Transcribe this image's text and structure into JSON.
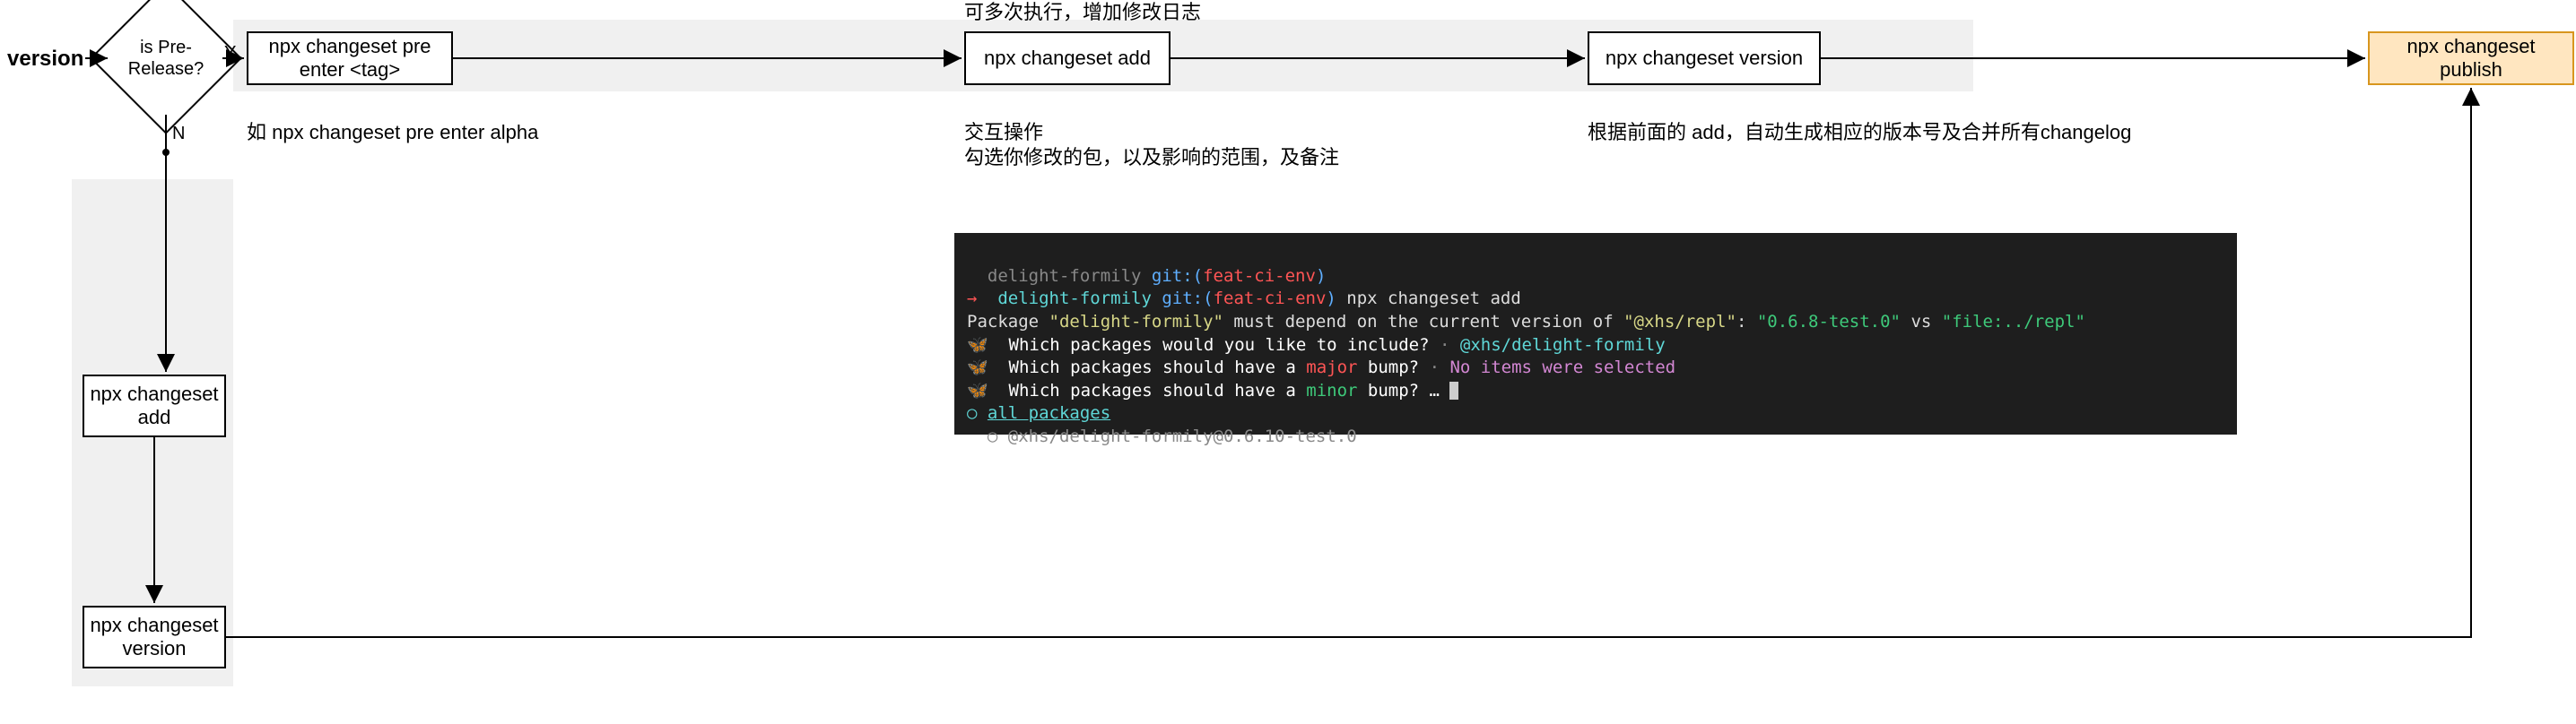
{
  "start": {
    "label": "version"
  },
  "decision": {
    "label": "is Pre-\nRelease?"
  },
  "branches": {
    "yes": "Y",
    "no": "N"
  },
  "topRow": {
    "preEnter": {
      "label": "npx changeset pre\nenter <tag>",
      "note": "如 npx changeset pre enter alpha"
    },
    "add": {
      "label": "npx changeset add",
      "noteTop": "可多次执行，增加修改日志",
      "noteBottom1": "交互操作",
      "noteBottom2": "勾选你修改的包，以及影响的范围，及备注"
    },
    "version": {
      "label": "npx changeset version",
      "note": "根据前面的 add，自动生成相应的版本号及合并所有changelog"
    }
  },
  "bottomCol": {
    "add": {
      "label": "npx changeset add"
    },
    "version": {
      "label": "npx changeset\nversion"
    }
  },
  "publish": {
    "label": "npx changeset publish"
  },
  "terminal": {
    "l1_a": "  delight-formily ",
    "l1_b": "git:(",
    "l1_c": "feat-ci-env",
    "l1_d": ")",
    "l2_arrow": "→",
    "l2_a": "  delight-formily ",
    "l2_b": "git:(",
    "l2_c": "feat-ci-env",
    "l2_d": ")",
    "l2_e": " npx changeset add",
    "l3_a": "Package ",
    "l3_b": "\"delight-formily\"",
    "l3_c": " must depend on the current version of ",
    "l3_d": "\"@xhs/repl\"",
    "l3_e": ": ",
    "l3_f": "\"0.6.8-test.0\"",
    "l3_g": " vs ",
    "l3_h": "\"file:../repl\"",
    "l4_icon": "🦋",
    "l4_a": "  Which packages would you like to include?",
    "l4_b": " · ",
    "l4_c": "@xhs/delight-formily",
    "l5_icon": "🦋",
    "l5_a": "  Which packages should have a ",
    "l5_b": "major",
    "l5_c": " bump?",
    "l5_d": " · ",
    "l5_e": "No items were selected",
    "l6_icon": "🦋",
    "l6_a": "  Which packages should have a ",
    "l6_b": "minor",
    "l6_c": " bump? … ",
    "l7_a": "○ ",
    "l7_b": "all packages",
    "l8_a": "  ○ @xhs/delight-formily@0.6.10-test.0"
  }
}
